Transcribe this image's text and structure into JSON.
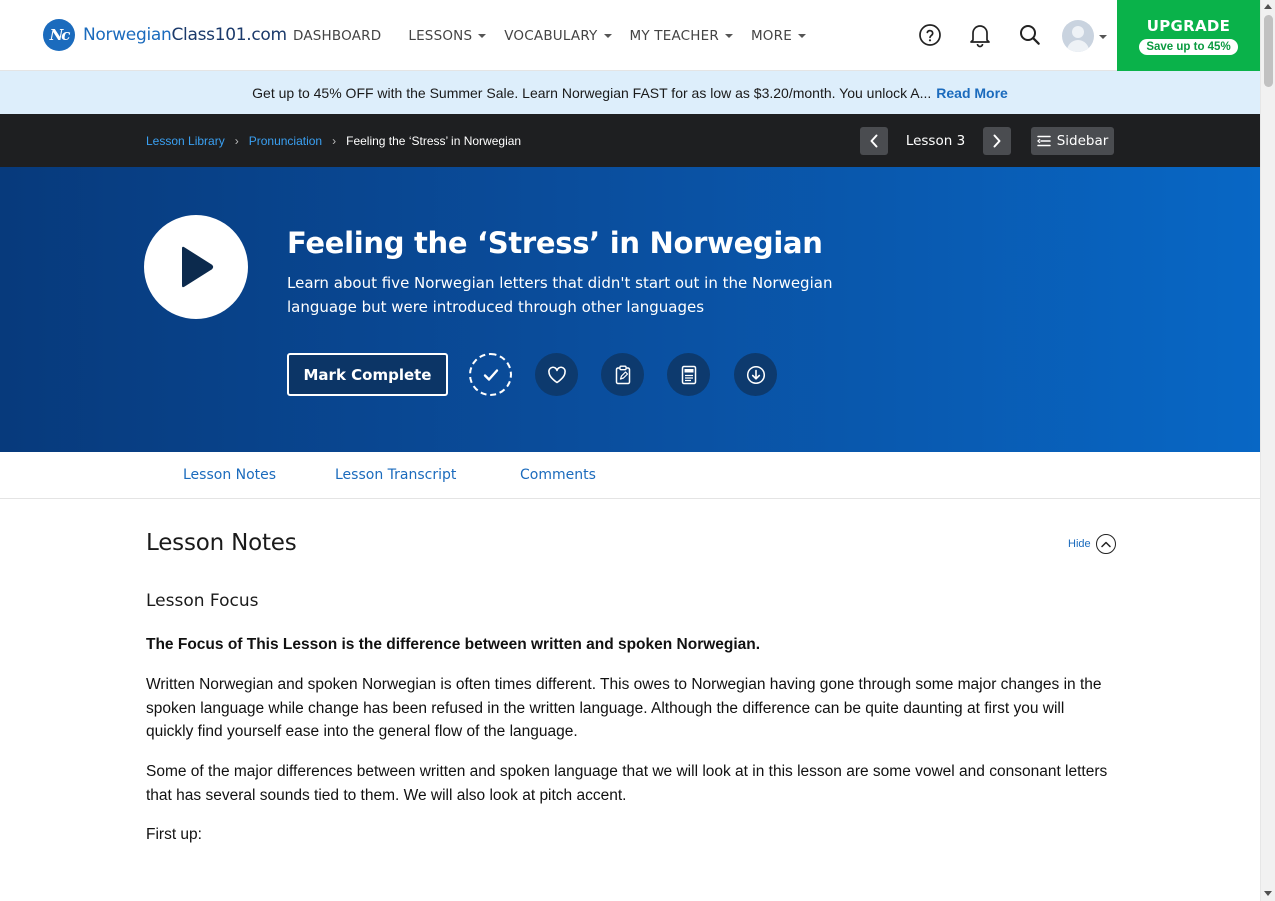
{
  "site": {
    "logo_mark": "Nc",
    "logo_prefix": "Norwegian",
    "logo_suffix": "Class101.com"
  },
  "nav": {
    "items": [
      {
        "label": "DASHBOARD",
        "dropdown": false
      },
      {
        "label": "LESSONS",
        "dropdown": true
      },
      {
        "label": "VOCABULARY",
        "dropdown": true
      },
      {
        "label": "MY TEACHER",
        "dropdown": true
      },
      {
        "label": "MORE",
        "dropdown": true
      }
    ]
  },
  "header_icons": [
    "help-icon",
    "bell-icon",
    "search-icon"
  ],
  "upgrade": {
    "title": "UPGRADE",
    "subtitle": "Save up to 45%",
    "color": "#0ab24a"
  },
  "promo": {
    "text": "Get up to 45% OFF with the Summer Sale. Learn Norwegian FAST for as low as $3.20/month. You unlock A...",
    "link": "Read More"
  },
  "breadcrumb": {
    "items": [
      "Lesson Library",
      "Pronunciation"
    ],
    "current": "Feeling the ‘Stress’ in Norwegian"
  },
  "lesson_nav": {
    "label": "Lesson 3",
    "sidebar_label": "Sidebar"
  },
  "hero": {
    "title": "Feeling the ‘Stress’ in Norwegian",
    "description": "Learn about five Norwegian letters that didn't start out in the Norwegian language but were introduced through other languages",
    "mark_complete": "Mark Complete",
    "action_icons": [
      "check-icon",
      "heart-icon",
      "clipboard-icon",
      "pdf-icon",
      "download-icon"
    ]
  },
  "tabs": [
    "Lesson Notes",
    "Lesson Transcript",
    "Comments"
  ],
  "notes": {
    "title": "Lesson Notes",
    "hide_label": "Hide",
    "subheading": "Lesson Focus",
    "focus": "The Focus of This Lesson is the difference between written and spoken Norwegian.",
    "paragraphs": [
      "Written Norwegian and spoken Norwegian is often times different. This owes to Norwegian having gone through some major changes in the spoken language while change has been refused in the written language. Although the difference can be quite daunting at first you will quickly find yourself ease into the general flow of the language.",
      "Some of the major differences between written and spoken language that we will look at in this lesson are some vowel and consonant let­ters that has several sounds tied to them. We will also look at pitch accent.",
      "First up:"
    ]
  },
  "colors": {
    "brand_blue": "#1b6bbd",
    "hero_dark": "#073a7c",
    "hero_light": "#0867c5",
    "promo_bg": "#ddeefb",
    "crumb_bar": "#1e1f21"
  }
}
